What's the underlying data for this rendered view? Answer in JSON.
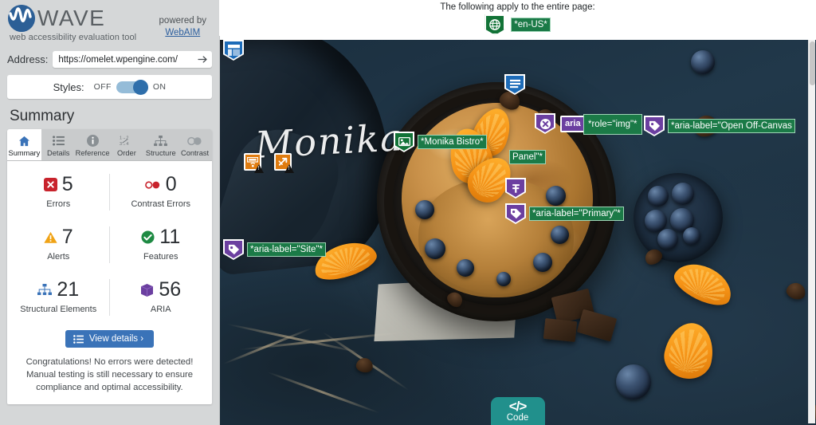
{
  "app": {
    "name": "WAVE",
    "tagline": "web accessibility evaluation tool",
    "powered_by": "powered by",
    "powered_link": "WebAIM",
    "logo_icon": "wave-logo-icon"
  },
  "address": {
    "label": "Address:",
    "value": "https://omelet.wpengine.com/",
    "go_icon": "arrow-right-icon"
  },
  "styles": {
    "label": "Styles:",
    "off": "OFF",
    "on": "ON",
    "state": "ON"
  },
  "summary": {
    "title": "Summary",
    "tabs": [
      {
        "label": "Summary",
        "icon": "home-icon",
        "active": true
      },
      {
        "label": "Details",
        "icon": "list-icon",
        "active": false
      },
      {
        "label": "Reference",
        "icon": "info-icon",
        "active": false
      },
      {
        "label": "Order",
        "icon": "order-icon",
        "active": false
      },
      {
        "label": "Structure",
        "icon": "structure-icon",
        "active": false
      },
      {
        "label": "Contrast",
        "icon": "contrast-icon",
        "active": false
      }
    ],
    "stats": [
      {
        "value": "5",
        "label": "Errors",
        "icon": "error-x-icon",
        "color": "#c8232c"
      },
      {
        "value": "0",
        "label": "Contrast Errors",
        "icon": "contrast-circle-icon",
        "color": "#c8232c"
      },
      {
        "value": "7",
        "label": "Alerts",
        "icon": "alert-triangle-icon",
        "color": "#f0a315"
      },
      {
        "value": "11",
        "label": "Features",
        "icon": "check-circle-icon",
        "color": "#1e8a43"
      },
      {
        "value": "21",
        "label": "Structural Elements",
        "icon": "structure-icon",
        "color": "#3a73b8"
      },
      {
        "value": "56",
        "label": "ARIA",
        "icon": "aria-cube-icon",
        "color": "#6b3fa0"
      }
    ],
    "details_button": "View details ›",
    "details_icon": "list-icon",
    "congrats": "Congratulations! No errors were detected! Manual testing is still necessary to ensure compliance and optimal accessibility."
  },
  "page_note": {
    "text": "The following apply to the entire page:",
    "icon": "language-globe-icon",
    "badge": "*en-US*"
  },
  "preview": {
    "brand_script": "Monika",
    "code_tab": {
      "glyph": "</>",
      "label": "Code",
      "color": "#21908c"
    }
  },
  "annotations": [
    {
      "id": "a1",
      "icon": "header-region-icon",
      "kind": "structure",
      "color": "#1c6bb8",
      "label": ""
    },
    {
      "id": "a2",
      "icon": "nav-region-icon",
      "kind": "structure",
      "color": "#1c6bb8",
      "label": ""
    },
    {
      "id": "a3",
      "icon": "alert-link-icon",
      "kind": "alert",
      "color": "#e07c10",
      "label": ""
    },
    {
      "id": "a4",
      "icon": "alert-redundant-link-icon",
      "kind": "alert",
      "color": "#e07c10",
      "label": ""
    },
    {
      "id": "a5",
      "icon": "image-alt-icon",
      "kind": "feature",
      "color": "#127337",
      "label": "*Monika Bistro*"
    },
    {
      "id": "a6",
      "icon": "aria-hidden-icon",
      "kind": "aria",
      "color": "#6b3fa0",
      "label": ""
    },
    {
      "id": "a7",
      "icon": "aria-chip",
      "kind": "aria",
      "color": "#6b3fa0",
      "label": "aria"
    },
    {
      "id": "a8",
      "icon": "role-label-icon",
      "kind": "feature",
      "color": "#127337",
      "label": "*role=\"img\"*"
    },
    {
      "id": "a9",
      "icon": "aria-label-tag-icon",
      "kind": "aria",
      "color": "#6b3fa0",
      "label": "*aria-label=\"Open Off-Canvas"
    },
    {
      "id": "a10",
      "icon": "panel-label-icon",
      "kind": "feature",
      "color": "#127337",
      "label": "Panel\"*"
    },
    {
      "id": "a11",
      "icon": "aria-nav-icon",
      "kind": "aria",
      "color": "#6b3fa0",
      "label": ""
    },
    {
      "id": "a12",
      "icon": "aria-label-tag-icon",
      "kind": "aria",
      "color": "#6b3fa0",
      "label": "*aria-label=\"Primary\"*"
    },
    {
      "id": "a13",
      "icon": "aria-label-tag-icon",
      "kind": "aria",
      "color": "#6b3fa0",
      "label": "*aria-label=\"Site\"*"
    }
  ]
}
